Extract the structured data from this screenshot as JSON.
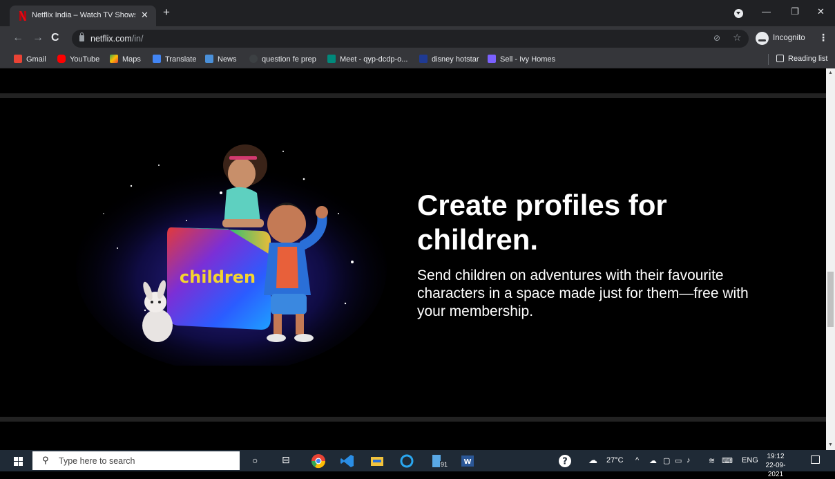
{
  "browser": {
    "tab_title": "Netflix India – Watch TV Shows O",
    "tab_close": "✕",
    "new_tab": "+",
    "url_host": "netflix.com",
    "url_path": "/in/",
    "incognito_label": "Incognito"
  },
  "bookmarks": [
    {
      "label": "Gmail",
      "icon": "gmail-icon",
      "color": "#ea4335"
    },
    {
      "label": "YouTube",
      "icon": "youtube-icon",
      "color": "#ff0000"
    },
    {
      "label": "Maps",
      "icon": "maps-icon",
      "color": "#34a853"
    },
    {
      "label": "Translate",
      "icon": "translate-icon",
      "color": "#4285f4"
    },
    {
      "label": "News",
      "icon": "news-icon",
      "color": "#4a90d9"
    },
    {
      "label": "question fe prep",
      "icon": "globe-icon",
      "color": "#3c4043"
    },
    {
      "label": "Meet - qyp-dcdp-o...",
      "icon": "meet-icon",
      "color": "#00897b"
    },
    {
      "label": "disney hotstar",
      "icon": "hotstar-icon",
      "color": "#1f3a93"
    },
    {
      "label": "Sell - Ivy Homes",
      "icon": "ivy-icon",
      "color": "#7b61ff"
    }
  ],
  "reading_list": "Reading list",
  "page": {
    "heading": "Create profiles for children.",
    "body": "Send children on adventures with their favourite characters in a space made just for them—free with your membership.",
    "illustration_label": "children"
  },
  "taskbar": {
    "search_placeholder": "Type here to search",
    "weather": "27°C",
    "language": "ENG",
    "time": "19:12",
    "date": "22-09-2021",
    "badge": "91"
  },
  "colors": {
    "netflix_red": "#e50914",
    "tab_bg": "#35363a",
    "frame_bg": "#202124",
    "taskbar_bg": "#1f2a36"
  }
}
